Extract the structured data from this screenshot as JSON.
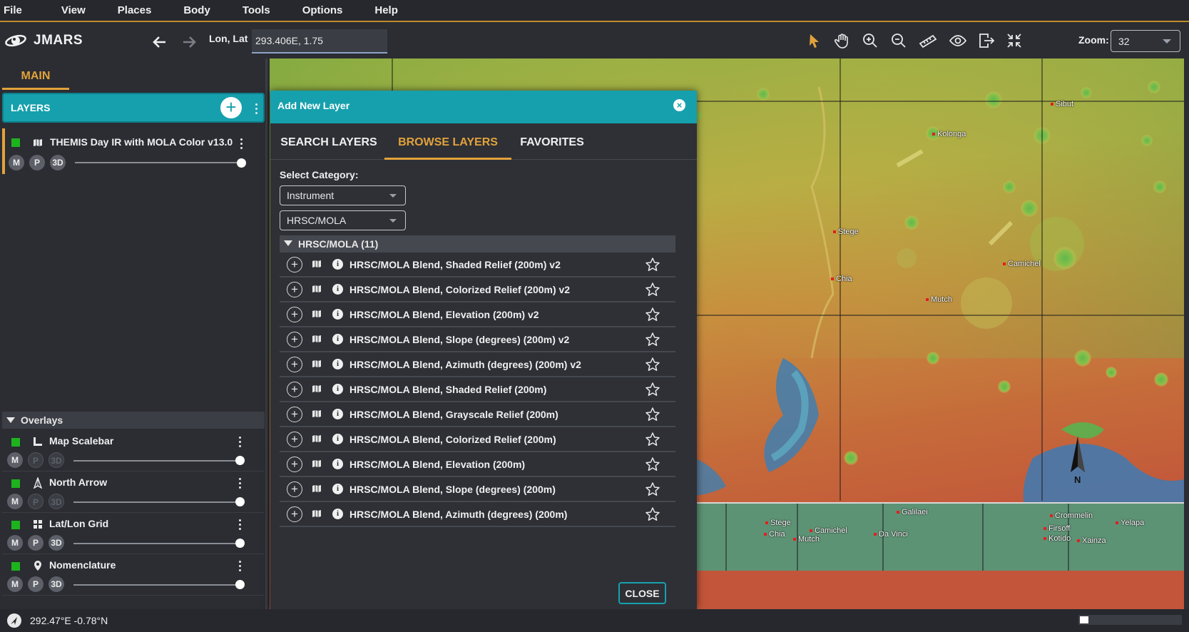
{
  "menu": [
    "File",
    "View",
    "Places",
    "Body",
    "Tools",
    "Options",
    "Help"
  ],
  "toolbar": {
    "app_name": "JMARS",
    "lonlat_label": "Lon, Lat",
    "lonlat_value": "293.406E, 1.75",
    "zoom_label": "Zoom:",
    "zoom_value": "32",
    "tools": [
      "select-arrow-icon",
      "pan-hand-icon",
      "zoom-in-icon",
      "zoom-out-icon",
      "ruler-icon",
      "eye-icon",
      "export-icon",
      "shrink-arrows-icon"
    ]
  },
  "left": {
    "main_tab": "MAIN",
    "layers_title": "LAYERS",
    "main_layer": {
      "name": "THEMIS Day IR with MOLA Color v13.0",
      "buttons": [
        "M",
        "P",
        "3D"
      ]
    },
    "overlays_title": "Overlays",
    "overlays": [
      {
        "name": "Map Scalebar",
        "icon": "ruler-corner-icon",
        "buttons": [
          "M",
          "P",
          "3D"
        ],
        "enabled": [
          true,
          false,
          false
        ]
      },
      {
        "name": "North Arrow",
        "icon": "north-arrow-icon",
        "buttons": [
          "M",
          "P",
          "3D"
        ],
        "enabled": [
          true,
          false,
          false
        ]
      },
      {
        "name": "Lat/Lon Grid",
        "icon": "grid-icon",
        "buttons": [
          "M",
          "P",
          "3D"
        ],
        "enabled": [
          true,
          true,
          true
        ]
      },
      {
        "name": "Nomenclature",
        "icon": "pin-icon",
        "buttons": [
          "M",
          "P",
          "3D"
        ],
        "enabled": [
          true,
          true,
          true
        ]
      }
    ]
  },
  "dialog": {
    "title": "Add New Layer",
    "tabs": [
      "SEARCH LAYERS",
      "BROWSE LAYERS",
      "FAVORITES"
    ],
    "active_tab": "BROWSE LAYERS",
    "select_category_label": "Select Category:",
    "category": "Instrument",
    "subcategory": "HRSC/MOLA",
    "group_title": "HRSC/MOLA (11)",
    "items": [
      "HRSC/MOLA Blend, Shaded Relief (200m) v2",
      "HRSC/MOLA Blend, Colorized Relief (200m) v2",
      "HRSC/MOLA Blend, Elevation (200m) v2",
      "HRSC/MOLA Blend, Slope (degrees) (200m) v2",
      "HRSC/MOLA Blend, Azimuth (degrees) (200m) v2",
      "HRSC/MOLA Blend, Shaded Relief (200m)",
      "HRSC/MOLA Blend, Grayscale Relief (200m)",
      "HRSC/MOLA Blend, Colorized Relief (200m)",
      "HRSC/MOLA Blend, Elevation (200m)",
      "HRSC/MOLA Blend, Slope (degrees) (200m)",
      "HRSC/MOLA Blend, Azimuth (degrees) (200m)"
    ],
    "close_label": "CLOSE"
  },
  "map": {
    "place_names": [
      "Sibut",
      "Kolonga",
      "Stege",
      "Camichel",
      "Chia",
      "Mutch"
    ],
    "panner_names": [
      "Galilaei",
      "Stege",
      "Chia",
      "Camichel",
      "Mutch",
      "Da Vinci",
      "Firsoff",
      "Kotido",
      "Xainza",
      "Crommelin",
      "Yelapa"
    ]
  },
  "status": {
    "coords": "292.47°E  -0.78°N"
  }
}
